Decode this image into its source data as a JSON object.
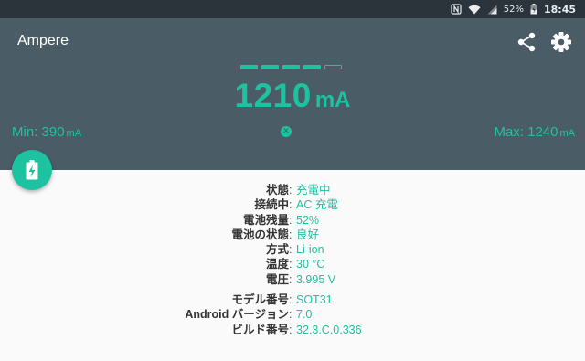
{
  "status_bar": {
    "battery_percent": "52%",
    "time": "18:45",
    "icons": [
      "nfc-icon",
      "wifi-icon",
      "signal-icon",
      "battery-charging-icon"
    ]
  },
  "app": {
    "title": "Ampere",
    "actions": [
      "share-icon",
      "settings-gear-icon"
    ]
  },
  "meter": {
    "level_segments_filled": 4,
    "level_segments_total": 5,
    "current_value": "1210",
    "current_unit": "mA",
    "min_label": "Min: 390",
    "min_unit": "mA",
    "max_label": "Max: 1240",
    "max_unit": "mA",
    "reset_icon": "close-circle-icon",
    "fab_icon": "battery-charging-icon"
  },
  "info": {
    "status_label": "状態",
    "status_value": "充電中",
    "connection_label": "接続中",
    "connection_value": "AC 充電",
    "level_label": "電池残量",
    "level_value": "52%",
    "health_label": "電池の状態",
    "health_value": "良好",
    "technology_label": "方式",
    "technology_value": "Li-ion",
    "temperature_label": "温度",
    "temperature_value": "30 °C",
    "voltage_label": "電圧",
    "voltage_value": "3.995 V",
    "model_label": "モデル番号",
    "model_value": "SOT31",
    "android_label": "Android バージョン",
    "android_value": "7.0",
    "build_label": "ビルド番号",
    "build_value": "32.3.C.0.336",
    "separator": ":"
  },
  "colors": {
    "accent": "#1dc2a0",
    "header": "#4a5c66",
    "status_bar": "#2b343a",
    "background": "#fafafa"
  }
}
